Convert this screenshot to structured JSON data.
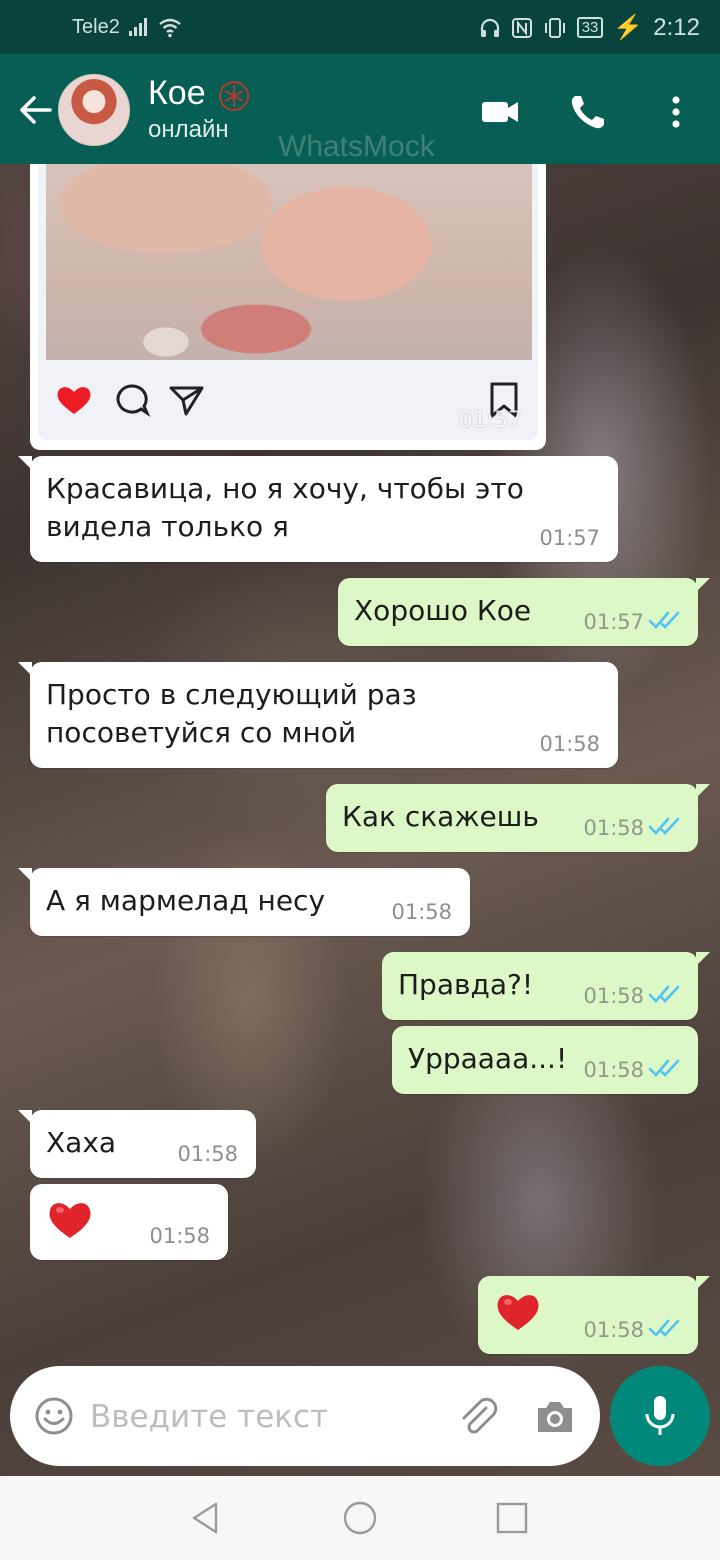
{
  "status_bar": {
    "carrier": "Tele2",
    "battery": "33",
    "time": "2:12"
  },
  "header": {
    "contact_name": "Кое",
    "contact_status": "онлайн",
    "watermark": "WhatsMock"
  },
  "post": {
    "time": "01:57"
  },
  "messages": [
    {
      "dir": "in",
      "lines": [
        "Красавица, но я хочу, чтобы это",
        "видела только я"
      ],
      "time": "01:57"
    },
    {
      "dir": "out",
      "lines": [
        "Хорошо Кое"
      ],
      "time": "01:57"
    },
    {
      "dir": "in",
      "lines": [
        "Просто в следующий раз",
        "посоветуйся со мной"
      ],
      "time": "01:58"
    },
    {
      "dir": "out",
      "lines": [
        "Как скажешь"
      ],
      "time": "01:58"
    },
    {
      "dir": "in",
      "lines": [
        "А я мармелад несу"
      ],
      "time": "01:58"
    },
    {
      "dir": "out",
      "lines": [
        "Правда?!"
      ],
      "time": "01:58"
    },
    {
      "dir": "out",
      "lines": [
        "Урраааа...!"
      ],
      "time": "01:58"
    },
    {
      "dir": "in",
      "lines": [
        "Хаха"
      ],
      "time": "01:58"
    },
    {
      "dir": "in",
      "emoji": "red-heart",
      "time": "01:58"
    },
    {
      "dir": "out",
      "emoji": "red-heart",
      "time": "01:58"
    }
  ],
  "input": {
    "placeholder": "Введите текст"
  },
  "colors": {
    "header": "#075e54",
    "status_bar": "#08433d",
    "outgoing_bubble": "#dcf8c6",
    "incoming_bubble": "#ffffff",
    "read_ticks": "#4fc3f7",
    "mic_button": "#00897b"
  }
}
